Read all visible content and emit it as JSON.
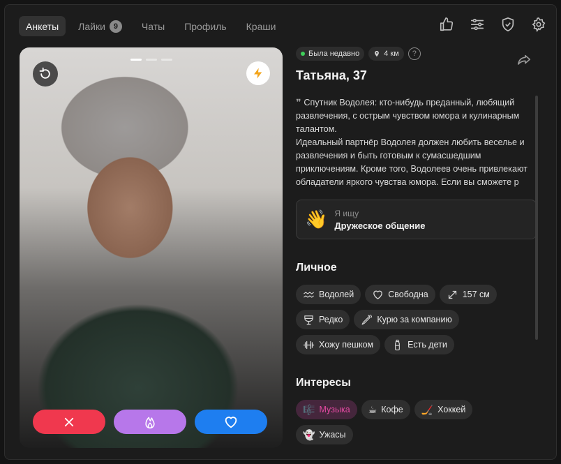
{
  "nav": {
    "tabs": [
      {
        "label": "Анкеты"
      },
      {
        "label": "Лайки",
        "badge": "9"
      },
      {
        "label": "Чаты"
      },
      {
        "label": "Профиль"
      },
      {
        "label": "Краши"
      }
    ],
    "icons": [
      "thumbs-up-icon",
      "filters-icon",
      "shield-icon",
      "settings-icon"
    ]
  },
  "profile": {
    "status": "Была недавно",
    "distance": "4 км",
    "help": "?",
    "name_age": "Татьяна, 37",
    "bio": "Спутник Водолея: кто-нибудь преданный, любящий развлечения, с острым чувством юмора и кулинарным талантом.\nИдеальный партнёр Водолея должен любить веселье и развлечения и быть готовым к сумасшедшим приключениям. Кроме того, Водолеев очень привлекают обладатели яркого чувства юмора. Если вы сможете р",
    "looking_label": "Я ищу",
    "looking_value": "Дружеское общение",
    "looking_emoji": "👋"
  },
  "personal": {
    "title": "Личное",
    "chips": [
      {
        "icon": "aquarius-icon",
        "label": "Водолей"
      },
      {
        "icon": "heart-outline-icon",
        "label": "Свободна"
      },
      {
        "icon": "height-icon",
        "label": "157 см"
      },
      {
        "icon": "glass-icon",
        "label": "Редко"
      },
      {
        "icon": "cigarette-icon",
        "label": "Курю за компанию"
      },
      {
        "icon": "dumbbell-icon",
        "label": "Хожу пешком"
      },
      {
        "icon": "baby-bottle-icon",
        "label": "Есть дети"
      }
    ]
  },
  "interests": {
    "title": "Интересы",
    "chips": [
      {
        "emoji": "🎼",
        "label": "Музыка",
        "highlight": true
      },
      {
        "emoji": "☕",
        "label": "Кофе"
      },
      {
        "emoji": "🏒",
        "label": "Хоккей"
      },
      {
        "emoji": "👻",
        "label": "Ужасы"
      }
    ]
  },
  "colors": {
    "dislike": "#f0384e",
    "superlike": "#b777ea",
    "like": "#1e7ef0",
    "interest_highlight": "#e34aa2"
  }
}
